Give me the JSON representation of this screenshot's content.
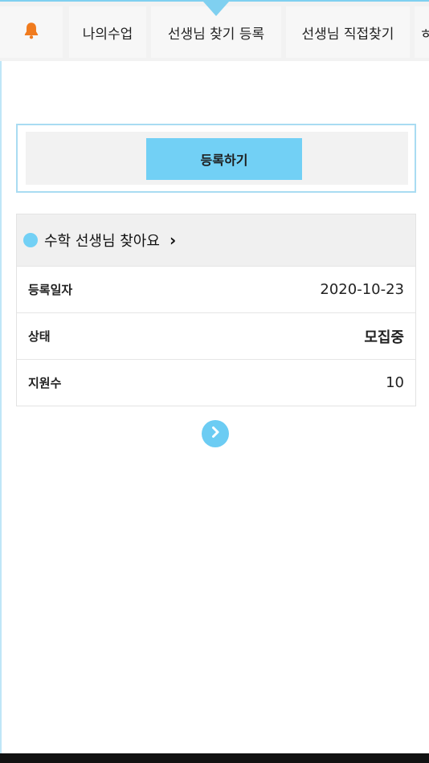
{
  "tabs": {
    "bell_icon": "bell-icon",
    "bell_color": "#f07b1e",
    "items": [
      {
        "label": "나의수업"
      },
      {
        "label": "선생님 찾기 등록"
      },
      {
        "label": "선생님 직접찾기"
      },
      {
        "label": "ㅎ"
      }
    ]
  },
  "register": {
    "button_label": "등록하기",
    "accent": "#72d0f5"
  },
  "card": {
    "title": "수학 선생님 찾아요",
    "chevron": "›",
    "rows": [
      {
        "label": "등록일자",
        "value": "2020-10-23"
      },
      {
        "label": "상태",
        "value": "모집중"
      },
      {
        "label": "지원수",
        "value": "10"
      }
    ]
  },
  "pager": {
    "next_icon": "chevron-right-icon"
  }
}
